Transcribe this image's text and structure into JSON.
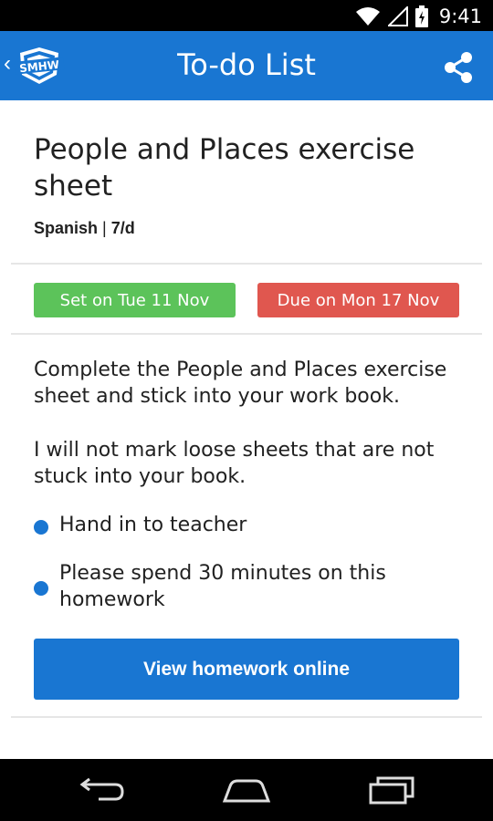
{
  "status_bar": {
    "time": "9:41",
    "icons": [
      "wifi-icon",
      "signal-icon",
      "battery-charging-icon"
    ]
  },
  "app_bar": {
    "logo_text": "SMHW",
    "title": "To-do List",
    "share_icon": "share-icon",
    "back_icon": "chevron-left-icon"
  },
  "homework": {
    "title": "People and Places exercise sheet",
    "subject": "Spanish",
    "separator": "|",
    "class": "7/d",
    "set_label": "Set on Tue 11 Nov",
    "due_label": "Due on Mon 17 Nov",
    "description": [
      "Complete the People and Places exercise sheet and stick into your work book.",
      "I will not mark loose sheets that are not stuck into your book."
    ],
    "bullets": [
      "Hand in to teacher",
      "Please spend 30 minutes on this homework"
    ],
    "view_button": "View homework online"
  },
  "colors": {
    "primary": "#1976d2",
    "set_green": "#5cc35a",
    "due_red": "#e0574f"
  },
  "nav_bar": {
    "icons": [
      "back-icon",
      "home-icon",
      "recents-icon"
    ]
  }
}
